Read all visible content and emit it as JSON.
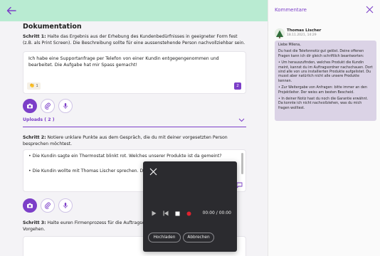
{
  "header": {
    "back_icon": "arrow-left-icon",
    "accent": "#b9ebd2"
  },
  "main": {
    "title": "Dokumentation",
    "step1": {
      "label": "Schritt 1:",
      "text": " Halte das Ergebnis aus der Erhebung des Kundenbedürfnisses in geeigneter Form fest (z.B. als Print Screen). Die Beschreibung sollte für eine aussenstehende Person nachvollziehbar sein.",
      "answer": "Ich habe eine Supportanfrage per Telefon von einer Kundin entgegengenommen und bearbeitet. Die Aufgabe hat mir Spass gemacht!",
      "likes": "1",
      "comment_count": "2"
    },
    "uploads_label": "Uploads ( 2 )",
    "step2": {
      "label": "Schritt 2:",
      "text": " Notiere unklare Punkte aus dem Gespräch, die du mit deiner vorgesetzten Person besprechen möchtest.",
      "bullets": [
        "• Die Kundin sagte ein Thermostat blinkt rot. Welches unserer Produkte ist da gemeint?",
        "• Die Kundin wollte mit Thomas Lischer sprechen. Der"
      ]
    },
    "step3": {
      "label": "Schritt 3:",
      "text": " Halte euren Firmenprozess für die Auftragser",
      "text2": "Vorgehen."
    }
  },
  "recorder": {
    "time": "00:00 / 00:00",
    "upload_label": "Hochladen",
    "cancel_label": "Abbrechen"
  },
  "comments": {
    "title": "Kommentare",
    "author": "Thomas Lischer",
    "date": "18.11.2021, 14:29",
    "paragraphs": [
      "Liebe Milena,",
      "Du hast die Telefonnotiz gut gelöst. Deine offenen Fragen kann ich dir gleich schriftlich beantworten:",
      "• Um herauszufinden, welches Produkt die Kundin meint, kannst du im Auftragsordner nachschauen. Dort sind alle von uns installierten Produkte aufgelistet. Du musst aber natürlich nicht alle unsere Produkte kennen.",
      "• Zur Weitergabe von Anfragen: bitte immer an den Projektleiter. Der weiss am besten Bescheid.",
      "• In deiner Notiz hast du noch die Garantie erwähnt. Da konnte ich nicht nachvollziehen, was du mich fragen wolltest."
    ]
  },
  "colors": {
    "accent": "#7c3fc8",
    "header": "#b9ebd2",
    "bubble": "#dbd3e6"
  }
}
